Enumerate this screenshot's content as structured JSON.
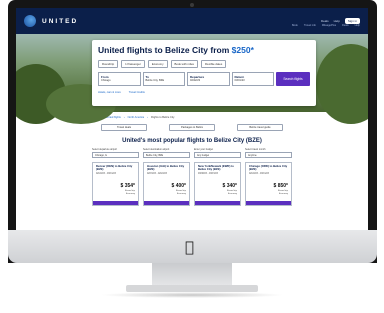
{
  "nav": {
    "brand": "UNITED",
    "links": [
      "Deals",
      "Help",
      "Sign in"
    ],
    "signin": "Sign in",
    "subnav": [
      "Book",
      "Travel info",
      "MileagePlus",
      "Deals",
      "Help"
    ]
  },
  "hero": {
    "title_prefix": "United flights to Belize City from ",
    "title_price": "$250*",
    "options": [
      "Roundtrip",
      "1 Passenger",
      "Economy",
      "Book with miles",
      "Flexible dates"
    ],
    "from": {
      "label": "From",
      "value": "Chicago"
    },
    "to": {
      "label": "To",
      "value": "Belize City, BZE"
    },
    "depart": {
      "label": "Departure",
      "value": "02/22/23"
    },
    "return": {
      "label": "Return",
      "value": "03/01/23"
    },
    "search_label": "Search flights",
    "links": [
      "Hotels, cars & more",
      "Travel Credits"
    ]
  },
  "breadcrumbs": [
    "Home",
    "United flights",
    "North America",
    "Flights to Belize City"
  ],
  "pills": [
    "Travel deals",
    "Packages to Belize",
    "Belize travel guide"
  ],
  "section_title": "United's most popular flights to Belize City (BZE)",
  "filters": [
    {
      "label": "Select departure airport",
      "value": "Chicago, IL"
    },
    {
      "label": "Select destination airport",
      "value": "Belize City, BZE"
    },
    {
      "label": "Enter your budget",
      "value": "Any budget"
    },
    {
      "label": "Select travel month",
      "value": "Anytime"
    }
  ],
  "tiles": [
    {
      "route": "Denver (DEN) to Belize City (BZE)",
      "dates": "02/22/23 - 03/01/23",
      "fare": "$ 354*",
      "meta": "Round trip\nEconomy"
    },
    {
      "route": "Houston (IAH) to Belize City (BZE)",
      "dates": "02/15/23 - 02/22/23",
      "fare": "$ 400*",
      "meta": "Round trip\nEconomy"
    },
    {
      "route": "New York/Newark (EWR) to Belize City (BZE)",
      "dates": "03/08/23 - 03/15/23",
      "fare": "$ 340*",
      "meta": "Round trip\nEconomy"
    },
    {
      "route": "Chicago (ORD) to Belize City (BZE)",
      "dates": "02/22/23 - 03/01/23",
      "fare": "$ 850*",
      "meta": "Round trip\nEconomy"
    }
  ],
  "colors": {
    "navy": "#0b1f4a",
    "accent": "#5b2fbf",
    "link": "#1866c7"
  }
}
